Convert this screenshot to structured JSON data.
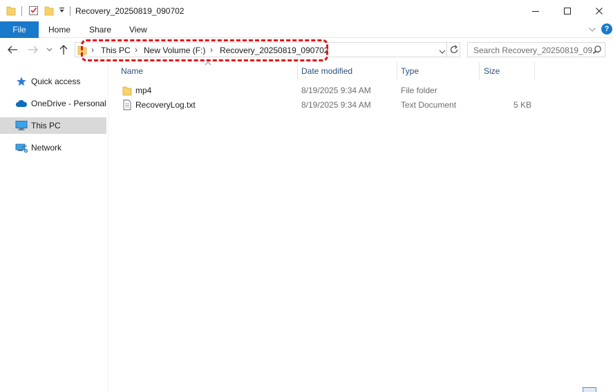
{
  "window": {
    "title": "Recovery_20250819_090702"
  },
  "ribbon": {
    "tabs": [
      {
        "label": "File"
      },
      {
        "label": "Home"
      },
      {
        "label": "Share"
      },
      {
        "label": "View"
      }
    ],
    "help_label": "?"
  },
  "address": {
    "crumbs": [
      {
        "label": "This PC"
      },
      {
        "label": "New Volume (F:)"
      },
      {
        "label": "Recovery_20250819_090702"
      }
    ],
    "separator": "›"
  },
  "search": {
    "placeholder": "Search Recovery_20250819_09..."
  },
  "sidebar": {
    "items": [
      {
        "label": "Quick access",
        "icon": "star-icon",
        "selected": false
      },
      {
        "label": "OneDrive - Personal",
        "icon": "cloud-icon",
        "selected": false
      },
      {
        "label": "This PC",
        "icon": "monitor-icon",
        "selected": true
      },
      {
        "label": "Network",
        "icon": "network-icon",
        "selected": false
      }
    ]
  },
  "columns": {
    "name": "Name",
    "date": "Date modified",
    "type": "Type",
    "size": "Size"
  },
  "files": [
    {
      "name": "mp4",
      "date": "8/19/2025 9:34 AM",
      "type": "File folder",
      "size": "",
      "icon": "folder-icon"
    },
    {
      "name": "RecoveryLog.txt",
      "date": "8/19/2025 9:34 AM",
      "type": "Text Document",
      "size": "5 KB",
      "icon": "text-file-icon"
    }
  ],
  "colors": {
    "accent": "#1979ca",
    "highlight": "#e0151b",
    "folder": "#f7d26b",
    "selected_bg": "#d9d9d9"
  }
}
